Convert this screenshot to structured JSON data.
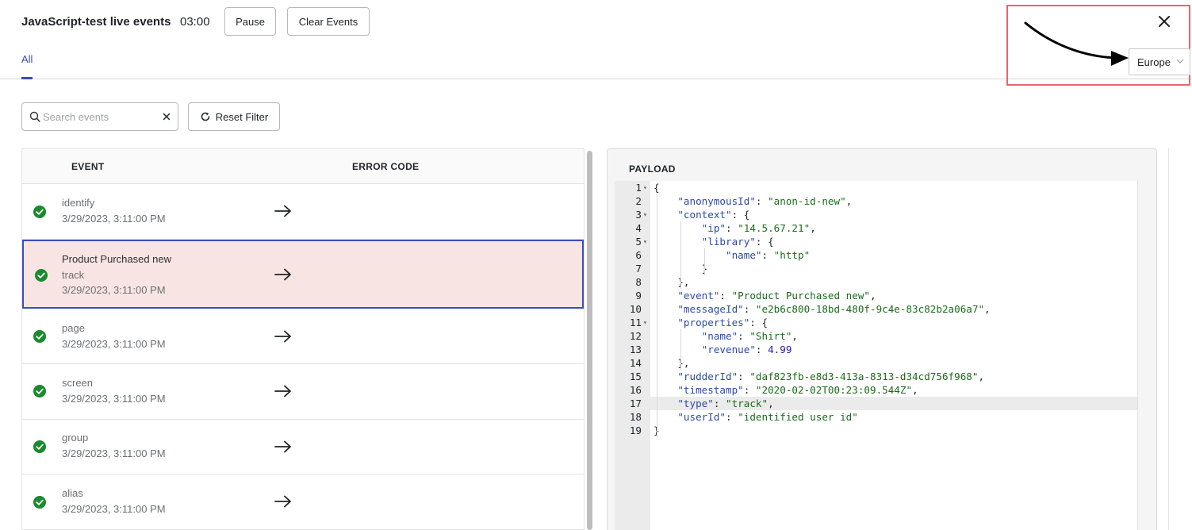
{
  "header": {
    "title": "JavaScript-test live events",
    "timer": "03:00",
    "pause_label": "Pause",
    "clear_label": "Clear Events",
    "tab_all": "All",
    "region": "Europe"
  },
  "filters": {
    "search_placeholder": "Search events",
    "reset_label": "Reset Filter"
  },
  "table": {
    "col_event": "EVENT",
    "col_error": "ERROR CODE",
    "rows": [
      {
        "name": "",
        "type": "identify",
        "time": "3/29/2023, 3:11:00 PM",
        "status": "success"
      },
      {
        "name": "Product Purchased new",
        "type": "track",
        "time": "3/29/2023, 3:11:00 PM",
        "status": "success",
        "selected": true
      },
      {
        "name": "",
        "type": "page",
        "time": "3/29/2023, 3:11:00 PM",
        "status": "success"
      },
      {
        "name": "",
        "type": "screen",
        "time": "3/29/2023, 3:11:00 PM",
        "status": "success"
      },
      {
        "name": "",
        "type": "group",
        "time": "3/29/2023, 3:11:00 PM",
        "status": "success"
      },
      {
        "name": "",
        "type": "alias",
        "time": "3/29/2023, 3:11:00 PM",
        "status": "success"
      }
    ]
  },
  "payload": {
    "title": "PAYLOAD",
    "active_line": 17,
    "lines": [
      "{",
      "    \"anonymousId\": \"anon-id-new\",",
      "    \"context\": {",
      "        \"ip\": \"14.5.67.21\",",
      "        \"library\": {",
      "            \"name\": \"http\"",
      "        }",
      "    },",
      "    \"event\": \"Product Purchased new\",",
      "    \"messageId\": \"e2b6c800-18bd-480f-9c4e-83c82b2a06a7\",",
      "    \"properties\": {",
      "        \"name\": \"Shirt\",",
      "        \"revenue\": 4.99",
      "    },",
      "    \"rudderId\": \"daf823fb-e8d3-413a-8313-d34cd756f968\",",
      "    \"timestamp\": \"2020-02-02T00:23:09.544Z\",",
      "    \"type\": \"track\",",
      "    \"userId\": \"identified user id\"",
      "}"
    ],
    "fold_lines": [
      1,
      3,
      5,
      11
    ]
  },
  "colors": {
    "accent": "#3b4cc0",
    "success": "#1a8a2e",
    "selected_row_bg": "#f8e5e3",
    "annotation_red": "#e5676b"
  }
}
